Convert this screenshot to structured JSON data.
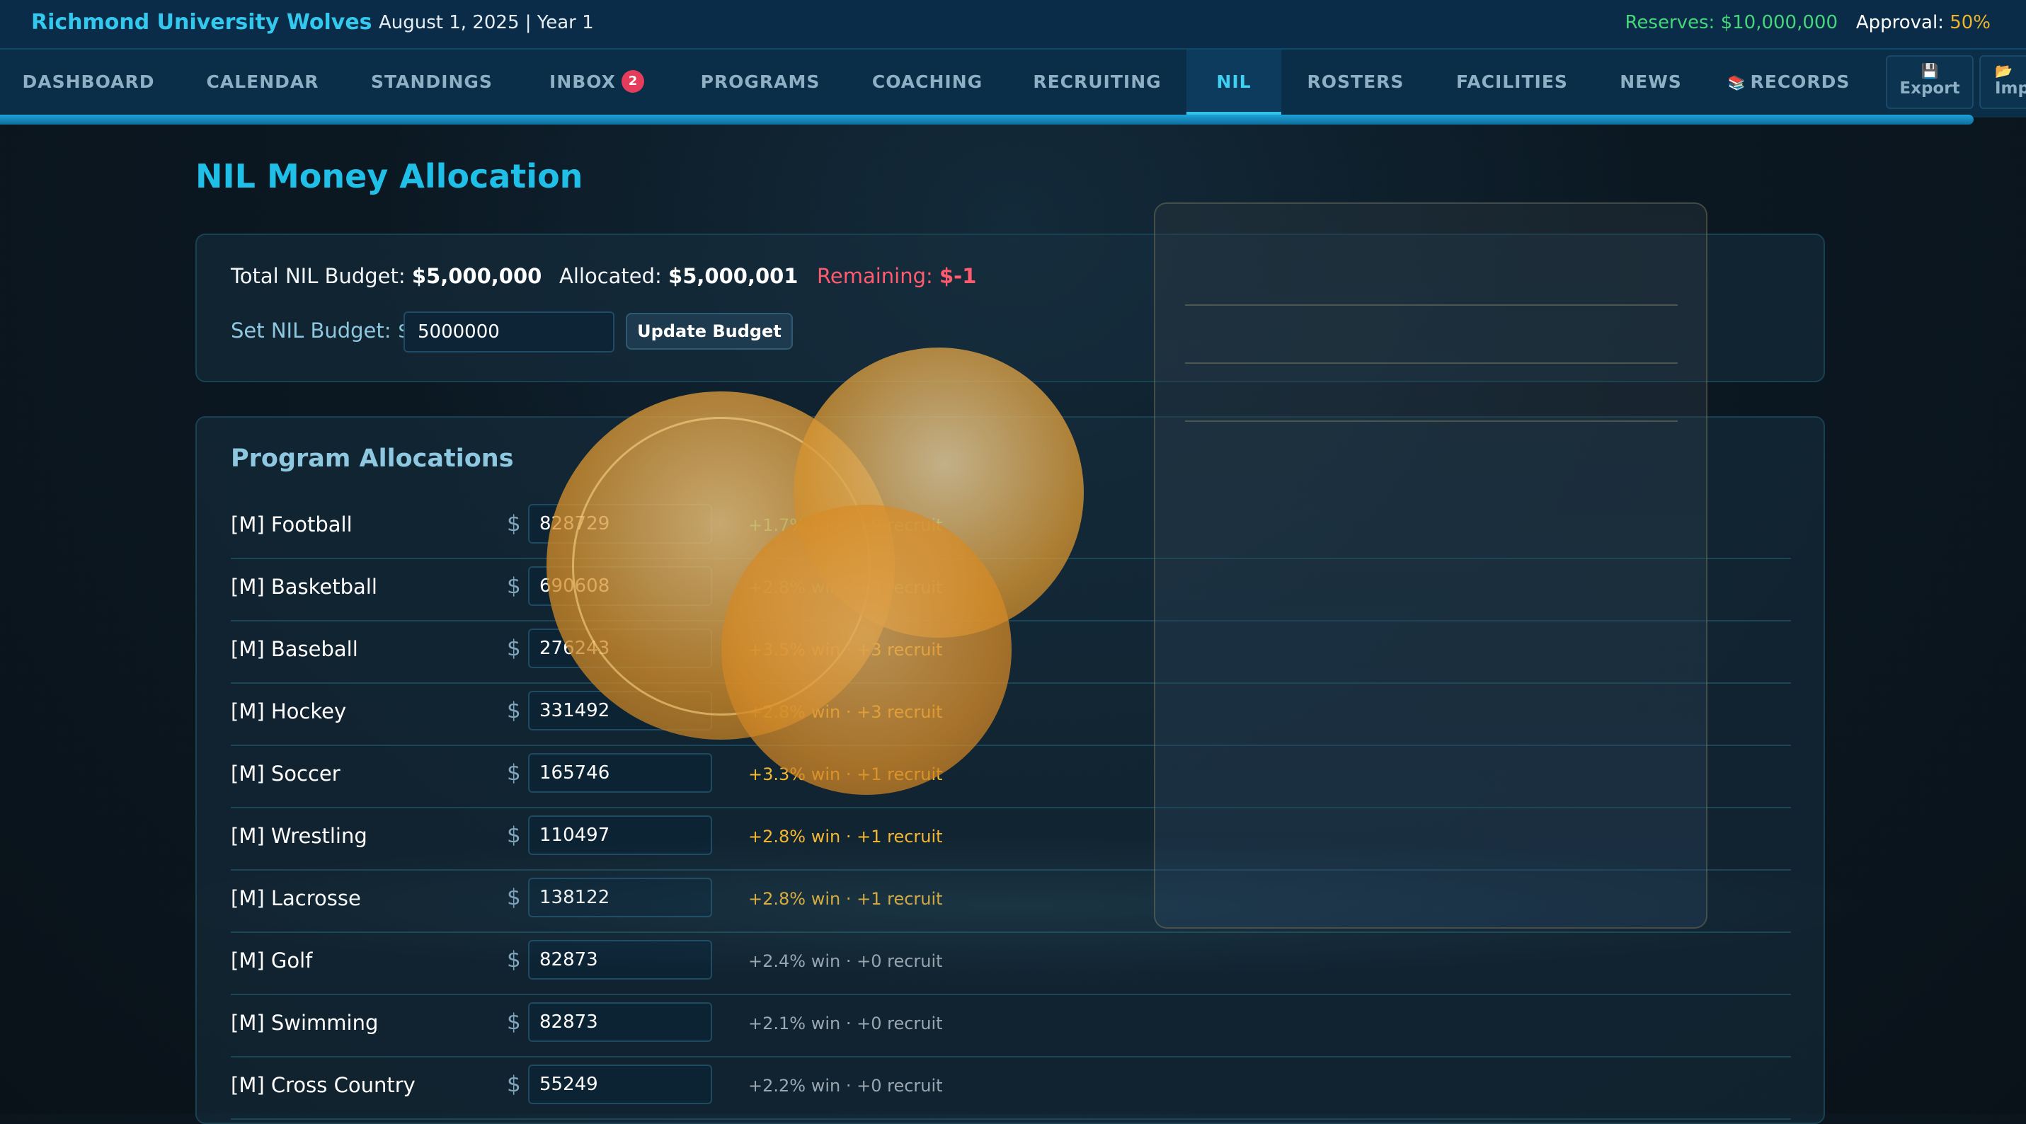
{
  "header": {
    "title": "Richmond University Wolves",
    "date": "August 1, 2025 | Year 1",
    "reserves": "Reserves: $10,000,000",
    "approval_label": "Approval: ",
    "approval_value": "50%"
  },
  "nav": {
    "items": [
      {
        "label": "DASHBOARD"
      },
      {
        "label": "CALENDAR"
      },
      {
        "label": "STANDINGS"
      },
      {
        "label": "INBOX",
        "badge": "2"
      },
      {
        "label": "PROGRAMS"
      },
      {
        "label": "COACHING"
      },
      {
        "label": "RECRUITING"
      },
      {
        "label": "NIL",
        "active": true
      },
      {
        "label": "ROSTERS"
      },
      {
        "label": "FACILITIES"
      },
      {
        "label": "NEWS"
      },
      {
        "label": "RECORDS",
        "icon": "books-icon"
      }
    ],
    "export_label": "Export",
    "import_label": "Imp"
  },
  "main": {
    "title": "NIL Money Allocation",
    "budget": {
      "total_label": "Total NIL Budget: ",
      "total_value": "$5,000,000",
      "allocated_label": "Allocated: ",
      "allocated_value": "$5,000,001",
      "remaining_label": "Remaining: ",
      "remaining_value": "$-1",
      "set_label": "Set NIL Budget: $",
      "input_value": "5000000",
      "update_label": "Update Budget"
    },
    "allocations": {
      "title": "Program Allocations",
      "currency": "$",
      "rows": [
        {
          "sport": "[M] Football",
          "amount": "828729",
          "effect": "+1.7% win · +9 recruit",
          "tier": "high"
        },
        {
          "sport": "[M] Basketball",
          "amount": "690608",
          "effect": "+2.8% win · +8 recruit",
          "tier": "high"
        },
        {
          "sport": "[M] Baseball",
          "amount": "276243",
          "effect": "+3.5% win · +3 recruit",
          "tier": "mid"
        },
        {
          "sport": "[M] Hockey",
          "amount": "331492",
          "effect": "+2.8% win · +3 recruit",
          "tier": "mid"
        },
        {
          "sport": "[M] Soccer",
          "amount": "165746",
          "effect": "+3.3% win · +1 recruit",
          "tier": "mid"
        },
        {
          "sport": "[M] Wrestling",
          "amount": "110497",
          "effect": "+2.8% win · +1 recruit",
          "tier": "mid"
        },
        {
          "sport": "[M] Lacrosse",
          "amount": "138122",
          "effect": "+2.8% win · +1 recruit",
          "tier": "mid"
        },
        {
          "sport": "[M] Golf",
          "amount": "82873",
          "effect": "+2.4% win · +0 recruit",
          "tier": "low"
        },
        {
          "sport": "[M] Swimming",
          "amount": "82873",
          "effect": "+2.1% win · +0 recruit",
          "tier": "low"
        },
        {
          "sport": "[M] Cross Country",
          "amount": "55249",
          "effect": "+2.2% win · +0 recruit",
          "tier": "low"
        }
      ]
    }
  },
  "colors": {
    "accent": "#1fbfe8",
    "effect_high": "#3ddc84",
    "effect_mid": "#f5b731",
    "effect_low": "#9aa7b0",
    "remaining": "#ff5a6e",
    "reserves": "#45d67c"
  }
}
